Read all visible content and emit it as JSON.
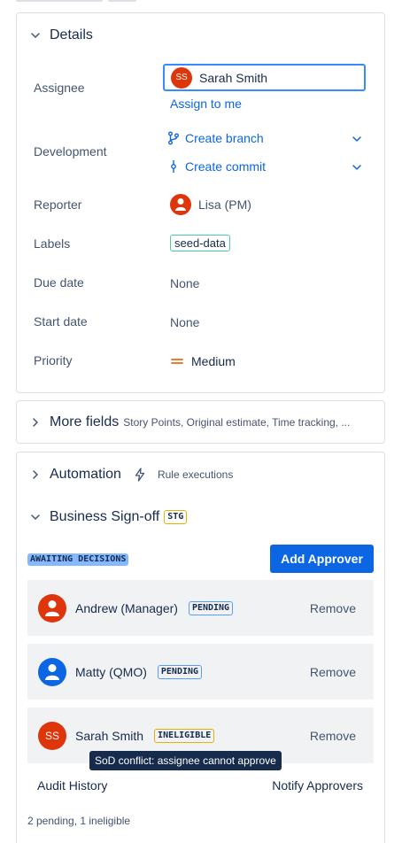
{
  "details": {
    "title": "Details",
    "fields": {
      "assignee": {
        "label": "Assignee",
        "initials": "SS",
        "value": "Sarah Smith",
        "assign_link": "Assign to me"
      },
      "development": {
        "label": "Development",
        "create_branch": "Create branch",
        "create_commit": "Create commit"
      },
      "reporter": {
        "label": "Reporter",
        "value": "Lisa (PM)"
      },
      "labels": {
        "label": "Labels",
        "value": "seed-data"
      },
      "due_date": {
        "label": "Due date",
        "value": "None"
      },
      "start_date": {
        "label": "Start date",
        "value": "None"
      },
      "priority": {
        "label": "Priority",
        "value": "Medium"
      }
    }
  },
  "more_fields": {
    "title": "More fields",
    "summary": "Story Points, Original estimate, Time tracking, ..."
  },
  "automation": {
    "title": "Automation",
    "subtitle": "Rule executions"
  },
  "signoff": {
    "title": "Business Sign-off",
    "env_badge": "STG",
    "status_badge": "AWAITING DECISIONS",
    "add_approver": "Add Approver",
    "approvers": [
      {
        "name": "Andrew (Manager)",
        "status": "PENDING",
        "remove": "Remove"
      },
      {
        "name": "Matty (QMO)",
        "status": "PENDING",
        "remove": "Remove"
      },
      {
        "name": "Sarah Smith",
        "initials": "SS",
        "status": "INELIGIBLE",
        "remove": "Remove"
      }
    ],
    "tooltip": "SoD conflict: assignee cannot approve",
    "audit_history": "Audit History",
    "notify_approvers": "Notify Approvers",
    "summary": "2 pending, 1 ineligible"
  },
  "colors": {
    "link": "#0c66e4",
    "primary_button": "#0c66e4",
    "avatar_red": "#de350b",
    "avatar_blue": "#0c66e4",
    "priority_medium": "#e56910",
    "label_tag_border": "#4bce97",
    "pending_border": "#579dff",
    "ineligible_border": "#e2b203",
    "awaiting_bg": "#85b8ff"
  }
}
